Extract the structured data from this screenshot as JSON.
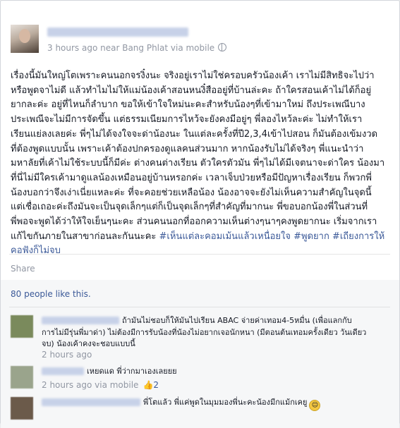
{
  "post": {
    "meta": "3 hours ago near Bang Phlat via mobile",
    "lines": [
      "เรื่องนี้มันใหญ่โตเพราะคนนอกจรงิ๋งนะ จริงอยู่เราไม่ใช่ครอบครัวน้องเค้า เราไม่มีสิทธิจะไปว่า",
      "หรือพูดจาไม่ดี แล้วทำไมไม่ให้แม่น้องเค้าสอนหนงิ๋สืออยู่ที่บ้านล่ะคะ ถ้าใครสอนเค้าไม่ได้ก็อยู่",
      "ยากละค่ะ อยู่ที่ไหนก็ลำบาก ขอให้เข้าใจใหม่นะคะสำหรับน้องๆที่เข้ามาใหม่ ถึงประเพณีบาง",
      "ประเพณีจะไม่มีการจัดขึ้น แต่ธรรมเนียมการไหว้จะยังคงมีอยู่ๆ พี่ลองไหว้ละค่ะ ไม่ทำให้เรา",
      "เรียนแย่ลงเลยค่ะ พี่ๆไม่ได้จงใจจะด่าน้องนะ ในแต่ละครั้งที่ปี2,3,4เข้าไปสอน ก็มันต้องเข้มงวด",
      "ที่ต้องพูดแบบนั้น เพราะเค้าต้องปกครองดูแลคนส่วนมาก หากน้องรับไม่ได้จริงๆ พี่แนะนำว่า",
      "มหาลัยที่เค้าไม่ใช้ระบบนี้ก็มีค่ะ ต่างคนต่างเรียน ตัวใครตัวมัน พี่ๆไม่ได้มีเจตนาจะด่าใคร น้องมา",
      "ที่นี่ไม่มีใครเค้ามาดูแลน้องเหมือนอยู่บ้านหรอกค่ะ เวลาเจ็บป่วยหรือมีปัญหาเรื่องเรียน ก็พวกพี่",
      "น้องบอกว่าจึงเง่าเนี่ยแหละค่ะ ที่จะคอยช่วยเหลือน้อง น้องอาจจะยังไม่เห็นความสำคัญในจุดนี้",
      "แต่เชื่อเถอะค่ะถึงมันจะเป็นจุดเล็กๆแต่ก็เป็นจุดเล็กๆที่สำคัญที่มากนะ พี่ขอบอกน้องพี่ในส่วนที่",
      "พี่พอจะพูดได้ว่าให้ใจเย็นๆนะคะ ส่วนคนนอกที่ออกความเห็นต่างๆนาๆคงพูดยากนะ เริ่มจากเรา",
      "แก้ไขกันภายในสาขาก่อนละกันนะคะ "
    ],
    "hashtags": "#เห็นแต่ละคอมเม้นแล้วเหนื่อยใจ #พูดยาก #เถียงการให้",
    "last_line": "คอฟังก็ไม่จบ"
  },
  "actions": {
    "share_label": "Share"
  },
  "likes": {
    "text": "80 people like this."
  },
  "comments": [
    {
      "lines": [
        "ถ้ามันไม่ชอบก็ให้มันไปเรียน ABAC จ่ายค่าเทอม4-5หมื่น (เพื่อแลกกับ",
        "การไม่มีรุ่นพี่มาด่า) ไม่ต้องมีการรับน้องที่น้องไม่อยากเจอนักหนา (มีตอนต้นเทอมครั้งเดียว วันเดียว",
        "จบ) น้องเค้าคงจะชอบแบบนี้"
      ],
      "meta": "2 hours ago",
      "avatar_color": "#7a8a5c"
    },
    {
      "lines": [
        "เหยดแด พี่ว่ากมาเองเลยยย"
      ],
      "meta": "2 hours ago via mobile",
      "like_count": "2",
      "avatar_color": "#9aa48c"
    },
    {
      "lines": [
        "พี่โตแล้ว พี่แค่พูดในมุมมองพี่นะคะน้องมีกแม้กเคยู"
      ],
      "avatar_color": "#6b5a4a"
    }
  ],
  "colors": {
    "link": "#3b5998",
    "meta": "#9197a3",
    "background": "#e9eaed"
  }
}
